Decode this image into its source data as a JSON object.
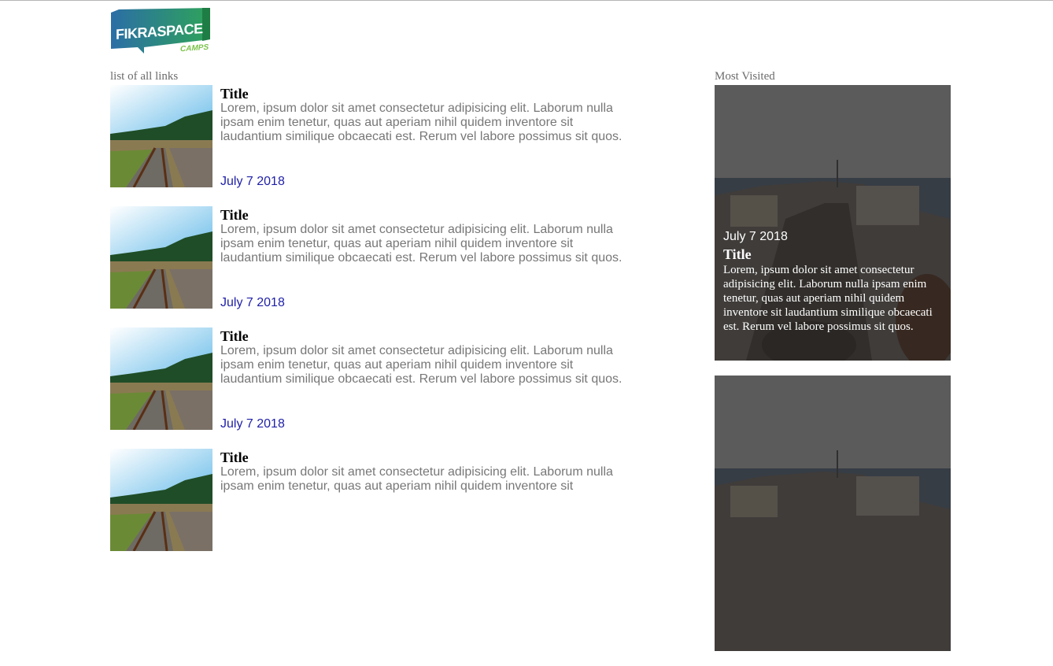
{
  "logo": {
    "text": "FIKRASPACE",
    "sub": "CAMPS"
  },
  "left_section": {
    "label": "list of all links"
  },
  "right_section": {
    "label": "Most Visited"
  },
  "articles": [
    {
      "title": "Title",
      "body": "Lorem, ipsum dolor sit amet consectetur adipisicing elit. Laborum nulla ipsam enim tenetur, quas aut aperiam nihil quidem inventore sit laudantium similique obcaecati est. Rerum vel labore possimus sit quos.",
      "date": "July 7 2018"
    },
    {
      "title": "Title",
      "body": "Lorem, ipsum dolor sit amet consectetur adipisicing elit. Laborum nulla ipsam enim tenetur, quas aut aperiam nihil quidem inventore sit laudantium similique obcaecati est. Rerum vel labore possimus sit quos.",
      "date": "July 7 2018"
    },
    {
      "title": "Title",
      "body": "Lorem, ipsum dolor sit amet consectetur adipisicing elit. Laborum nulla ipsam enim tenetur, quas aut aperiam nihil quidem inventore sit laudantium similique obcaecati est. Rerum vel labore possimus sit quos.",
      "date": "July 7 2018"
    },
    {
      "title": "Title",
      "body": "Lorem, ipsum dolor sit amet consectetur adipisicing elit. Laborum nulla ipsam enim tenetur, quas aut aperiam nihil quidem inventore sit",
      "date": ""
    }
  ],
  "most_visited": [
    {
      "date": "July 7 2018",
      "title": "Title",
      "body": "Lorem, ipsum dolor sit amet consectetur adipisicing elit. Laborum nulla ipsam enim tenetur, quas aut aperiam nihil quidem inventore sit laudantium similique obcaecati est. Rerum vel labore possimus sit quos."
    },
    {
      "date": "",
      "title": "",
      "body": ""
    }
  ],
  "colors": {
    "date_link": "#1f1fa8",
    "body_text": "#777777",
    "logo_green": "#2a9d5c",
    "logo_blue": "#1f6f8b"
  }
}
